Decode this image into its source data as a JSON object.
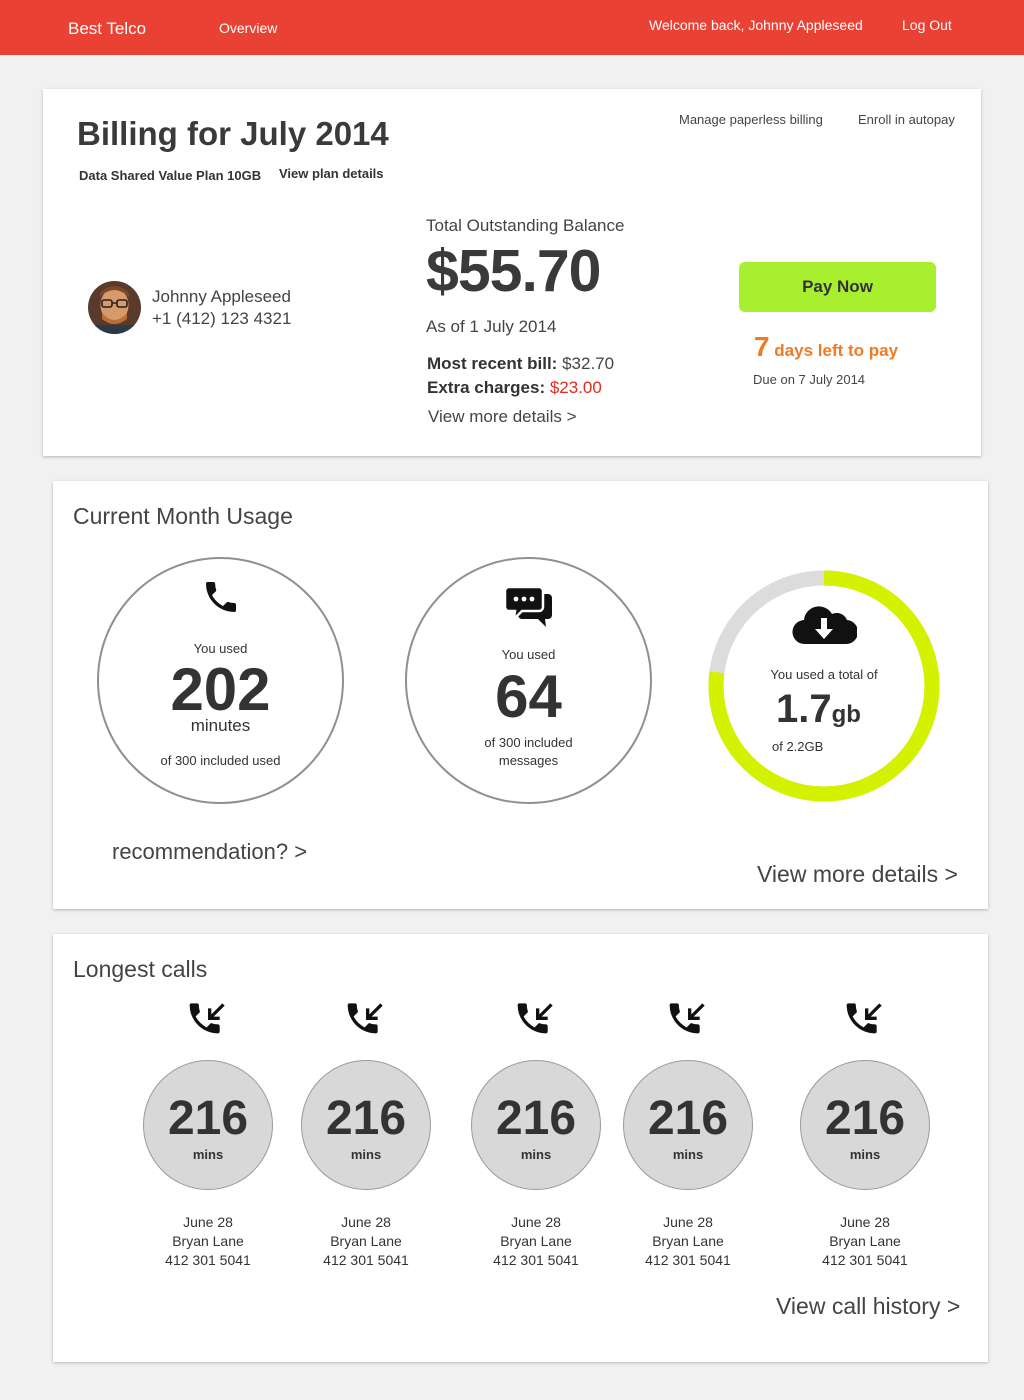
{
  "nav": {
    "brand": "Best Telco",
    "overview": "Overview",
    "welcome": "Welcome back, Johnny Appleseed",
    "logout": "Log Out"
  },
  "billing": {
    "title": "Billing for July 2014",
    "plan_name": "Data Shared Value Plan 10GB",
    "plan_link": "View plan details",
    "paperless_link": "Manage paperless billing",
    "autopay_link": "Enroll in autopay",
    "user_name": "Johnny Appleseed",
    "user_phone": "+1 (412) 123 4321",
    "balance_label": "Total Outstanding Balance",
    "balance_amount": "$55.70",
    "as_of": "As of 1 July 2014",
    "recent_label": "Most recent bill:",
    "recent_value": " $32.70",
    "extra_label": "Extra charges:",
    "extra_value": " $23.00",
    "details_link": "View more details >",
    "pay_button": "Pay Now",
    "days_left_num": "7",
    "days_left_text": " days left to pay",
    "due_on": "Due on 7 July 2014"
  },
  "usage": {
    "title": "Current Month Usage",
    "calls": {
      "you_used": "You used",
      "value": "202",
      "unit": "minutes",
      "note": "of 300 included used"
    },
    "messages": {
      "you_used": "You used",
      "value": "64",
      "note_line1": "of 300 included",
      "note_line2": "messages"
    },
    "data": {
      "you_used": "You used a total of",
      "value": "1.7",
      "unit": "gb",
      "note": "of 2.2GB",
      "fraction_used": 0.77
    },
    "recommendation_link": "recommendation? >",
    "details_link": "View more details >"
  },
  "longest_calls": {
    "title": "Longest calls",
    "unit": "mins",
    "calls": [
      {
        "mins": "216",
        "date": "June 28",
        "name": "Bryan Lane",
        "number": "412 301 5041"
      },
      {
        "mins": "216",
        "date": "June 28",
        "name": "Bryan Lane",
        "number": "412 301 5041"
      },
      {
        "mins": "216",
        "date": "June 28",
        "name": "Bryan Lane",
        "number": "412 301 5041"
      },
      {
        "mins": "216",
        "date": "June 28",
        "name": "Bryan Lane",
        "number": "412 301 5041"
      },
      {
        "mins": "216",
        "date": "June 28",
        "name": "Bryan Lane",
        "number": "412 301 5041"
      }
    ],
    "history_link": "View call history >"
  },
  "colors": {
    "header": "#e94235",
    "pay_button": "#a8ef2f",
    "days_left": "#f07a22",
    "extra_charges": "#e02b20",
    "data_ring_used": "#d4f200",
    "data_ring_track": "#dcdcdc"
  },
  "icons": [
    "phone-icon",
    "chat-bubbles-icon",
    "cloud-download-icon",
    "incoming-call-icon",
    "avatar"
  ]
}
